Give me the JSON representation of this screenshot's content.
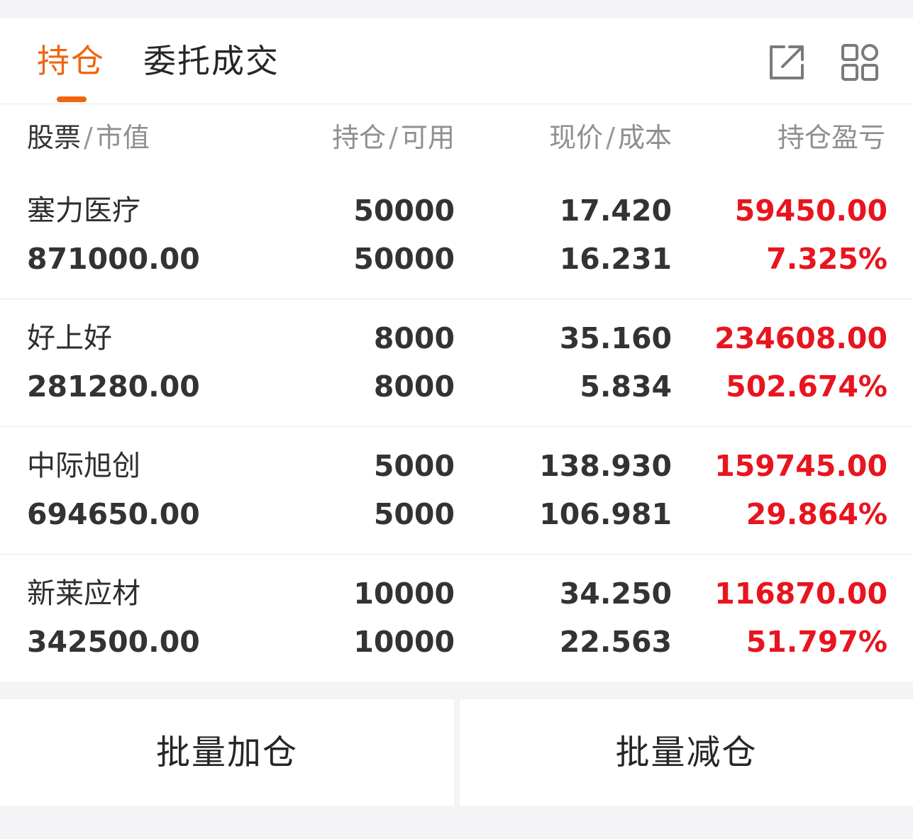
{
  "tabs": {
    "active_label": "持仓",
    "inactive_label": "委托成交"
  },
  "header_icons": [
    "share-icon",
    "grid-icon"
  ],
  "table": {
    "headers": {
      "col1_main": "股票",
      "col1_sub": "市值",
      "col2_main": "持仓",
      "col2_sub": "可用",
      "col3_main": "现价",
      "col3_sub": "成本",
      "col4": "持仓盈亏"
    },
    "rows": [
      {
        "name": "塞力医疗",
        "market_value": "871000.00",
        "position": "50000",
        "available": "50000",
        "price": "17.420",
        "cost": "16.231",
        "pnl": "59450.00",
        "pnl_pct": "7.325%"
      },
      {
        "name": "好上好",
        "market_value": "281280.00",
        "position": "8000",
        "available": "8000",
        "price": "35.160",
        "cost": "5.834",
        "pnl": "234608.00",
        "pnl_pct": "502.674%"
      },
      {
        "name": "中际旭创",
        "market_value": "694650.00",
        "position": "5000",
        "available": "5000",
        "price": "138.930",
        "cost": "106.981",
        "pnl": "159745.00",
        "pnl_pct": "29.864%"
      },
      {
        "name": "新莱应材",
        "market_value": "342500.00",
        "position": "10000",
        "available": "10000",
        "price": "34.250",
        "cost": "22.563",
        "pnl": "116870.00",
        "pnl_pct": "51.797%"
      }
    ]
  },
  "buttons": {
    "batch_add": "批量加仓",
    "batch_reduce": "批量减仓"
  },
  "colors": {
    "accent": "#f0650f",
    "profit_red": "#e8141e"
  }
}
